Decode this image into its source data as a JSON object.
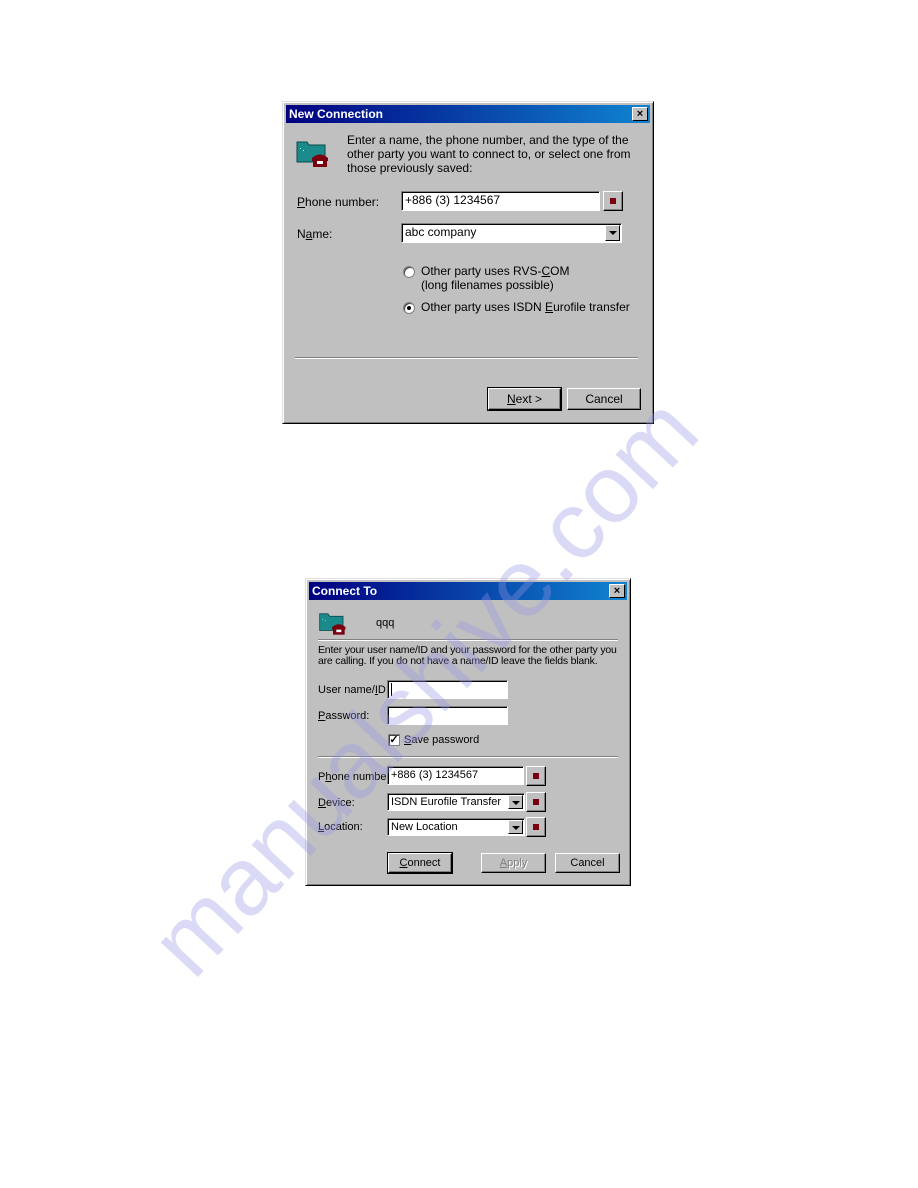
{
  "dialog1": {
    "title": "New Connection",
    "close_label": "×",
    "icon": "folder-phone-icon",
    "intro": "Enter a name, the phone number, and the type of the other party you want to connect to, or select one from those previously saved:",
    "phone_label_pre": "",
    "phone_label_u": "P",
    "phone_label_post": "hone number:",
    "phone_value": "+886 (3) 1234567",
    "name_label_pre": "N",
    "name_label_u": "a",
    "name_label_post": "me:",
    "name_value": "abc company",
    "radio1_line1_pre": "Other party uses RVS-",
    "radio1_line1_u": "C",
    "radio1_line1_post": "OM",
    "radio1_line2": "(long filenames possible)",
    "radio1_selected": false,
    "radio2_pre": "Other party uses ISDN ",
    "radio2_u": "E",
    "radio2_post": "urofile transfer",
    "radio2_selected": true,
    "next_u": "N",
    "next_post": "ext >",
    "cancel_label": "Cancel"
  },
  "dialog2": {
    "title": "Connect To",
    "close_label": "×",
    "icon": "folder-phone-icon",
    "connection_name": "qqq",
    "intro": "Enter your user name/ID and your password for the other party you are calling. If you do not have a name/ID leave the fields blank.",
    "user_label_pre": "User name/",
    "user_label_u": "I",
    "user_label_post": "D:",
    "user_value": "",
    "password_label_u": "P",
    "password_label_post": "assword:",
    "password_value": "",
    "save_password_u": "S",
    "save_password_post": "ave password",
    "save_password_checked": true,
    "check_mark": "✓",
    "phone_label_pre": "P",
    "phone_label_u": "h",
    "phone_label_post": "one number:",
    "phone_value": "+886 (3) 1234567",
    "device_label_u": "D",
    "device_label_post": "evice:",
    "device_value": "ISDN Eurofile Transfer",
    "location_label_u": "L",
    "location_label_post": "ocation:",
    "location_value": "New Location",
    "connect_u": "C",
    "connect_post": "onnect",
    "apply_u": "A",
    "apply_post": "pply",
    "cancel_label": "Cancel"
  },
  "watermark": "manualshive.com",
  "colors": {
    "title_start": "#000080",
    "title_end": "#1084d0",
    "dialog_bg": "#c0c0c0",
    "icon_folder": "#1a8a8a",
    "icon_phone": "#7a0010"
  }
}
